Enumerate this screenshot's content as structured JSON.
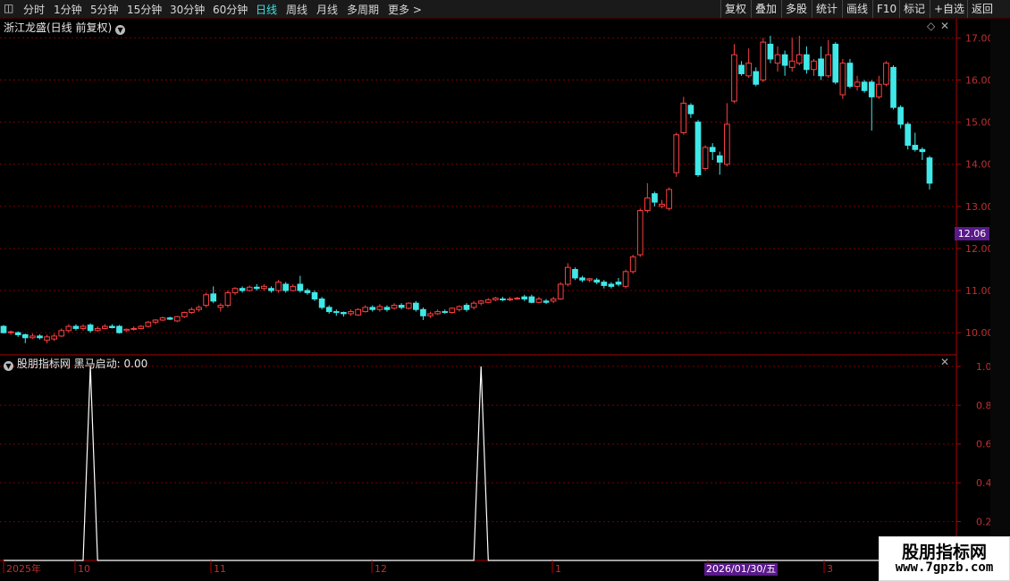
{
  "toolbar": {
    "periods": [
      "分时",
      "1分钟",
      "5分钟",
      "15分钟",
      "30分钟",
      "60分钟",
      "日线",
      "周线",
      "月线",
      "多周期",
      "更多 >"
    ],
    "active_period": "日线",
    "right_buttons": [
      "复权",
      "叠加",
      "多股",
      "统计",
      "画线",
      "F10",
      "标记",
      "+自选",
      "返回"
    ]
  },
  "main_header": {
    "title": "浙江龙盛(日线 前复权)"
  },
  "sub_header": {
    "title": "股朋指标网 黑马启动: 0.00"
  },
  "price_axis": {
    "ticks": [
      "17.00",
      "16.00",
      "15.00",
      "14.00",
      "13.00",
      "12.00",
      "11.00",
      "10.00"
    ],
    "current": "12.06"
  },
  "indicator_axis": {
    "ticks": [
      "1.00",
      "0.80",
      "0.60",
      "0.40",
      "0.20"
    ]
  },
  "time_axis": {
    "labels": [
      "2025年",
      "10",
      "11",
      "12",
      "1",
      "2",
      "3"
    ],
    "cursor_date": "2026/01/30/五"
  },
  "watermark": {
    "title": "股朋指标网",
    "url": "www.7gpzb.com"
  },
  "colors": {
    "up": "#ff4040",
    "down": "#40e8e8",
    "indicator": "#ffffff",
    "grid": "#7a0000",
    "axis": "#b00000",
    "label": "#c03030"
  },
  "chart_data": [
    {
      "type": "candlestick",
      "title": "浙江龙盛(日线 前复权)",
      "ylim": [
        9.6,
        17.2
      ],
      "candles": [
        [
          10.15,
          10.0,
          10.18,
          9.98
        ],
        [
          10.0,
          10.02,
          10.05,
          9.95
        ],
        [
          10.0,
          9.95,
          10.03,
          9.9
        ],
        [
          9.95,
          9.88,
          9.98,
          9.75
        ],
        [
          9.88,
          9.92,
          9.98,
          9.85
        ],
        [
          9.92,
          9.88,
          9.96,
          9.84
        ],
        [
          9.82,
          9.9,
          9.95,
          9.75
        ],
        [
          9.85,
          9.92,
          9.98,
          9.8
        ],
        [
          9.92,
          10.05,
          10.1,
          9.9
        ],
        [
          10.05,
          10.15,
          10.2,
          10.0
        ],
        [
          10.15,
          10.1,
          10.2,
          10.05
        ],
        [
          10.1,
          10.15,
          10.2,
          10.05
        ],
        [
          10.18,
          10.05,
          10.22,
          10.0
        ],
        [
          10.05,
          10.1,
          10.15,
          10.02
        ],
        [
          10.1,
          10.15,
          10.2,
          10.08
        ],
        [
          10.15,
          10.12,
          10.2,
          10.1
        ],
        [
          10.15,
          10.0,
          10.18,
          9.98
        ],
        [
          10.05,
          10.08,
          10.1,
          10.02
        ],
        [
          10.08,
          10.1,
          10.15,
          10.05
        ],
        [
          10.1,
          10.15,
          10.18,
          10.08
        ],
        [
          10.15,
          10.25,
          10.28,
          10.12
        ],
        [
          10.25,
          10.3,
          10.32,
          10.2
        ],
        [
          10.3,
          10.35,
          10.38,
          10.28
        ],
        [
          10.35,
          10.32,
          10.38,
          10.3
        ],
        [
          10.28,
          10.38,
          10.4,
          10.25
        ],
        [
          10.38,
          10.48,
          10.5,
          10.35
        ],
        [
          10.48,
          10.55,
          10.6,
          10.45
        ],
        [
          10.55,
          10.6,
          10.65,
          10.5
        ],
        [
          10.65,
          10.9,
          10.95,
          10.6
        ],
        [
          10.92,
          10.75,
          11.1,
          10.7
        ],
        [
          10.6,
          10.65,
          10.7,
          10.5
        ],
        [
          10.65,
          10.95,
          11.0,
          10.6
        ],
        [
          10.95,
          11.05,
          11.08,
          10.9
        ],
        [
          11.05,
          11.0,
          11.1,
          10.95
        ],
        [
          11.0,
          11.08,
          11.12,
          10.98
        ],
        [
          11.08,
          11.05,
          11.15,
          11.0
        ],
        [
          11.05,
          11.1,
          11.15,
          11.0
        ],
        [
          11.05,
          11.0,
          11.1,
          10.95
        ],
        [
          11.0,
          11.2,
          11.25,
          10.95
        ],
        [
          11.15,
          11.0,
          11.2,
          10.95
        ],
        [
          11.0,
          11.1,
          11.15,
          10.98
        ],
        [
          11.15,
          11.0,
          11.35,
          10.95
        ],
        [
          11.0,
          10.95,
          11.05,
          10.9
        ],
        [
          10.95,
          10.8,
          11.0,
          10.75
        ],
        [
          10.8,
          10.6,
          10.85,
          10.55
        ],
        [
          10.6,
          10.5,
          10.65,
          10.45
        ],
        [
          10.5,
          10.48,
          10.55,
          10.4
        ],
        [
          10.48,
          10.45,
          10.5,
          10.38
        ],
        [
          10.45,
          10.5,
          10.55,
          10.4
        ],
        [
          10.42,
          10.55,
          10.58,
          10.4
        ],
        [
          10.5,
          10.6,
          10.65,
          10.48
        ],
        [
          10.6,
          10.55,
          10.65,
          10.5
        ],
        [
          10.55,
          10.62,
          10.68,
          10.5
        ],
        [
          10.6,
          10.55,
          10.65,
          10.5
        ],
        [
          10.58,
          10.65,
          10.7,
          10.55
        ],
        [
          10.65,
          10.6,
          10.7,
          10.55
        ],
        [
          10.58,
          10.7,
          10.72,
          10.55
        ],
        [
          10.7,
          10.55,
          10.75,
          10.5
        ],
        [
          10.55,
          10.4,
          10.6,
          10.3
        ],
        [
          10.4,
          10.45,
          10.5,
          10.35
        ],
        [
          10.45,
          10.5,
          10.55,
          10.42
        ],
        [
          10.5,
          10.48,
          10.55,
          10.45
        ],
        [
          10.48,
          10.58,
          10.6,
          10.45
        ],
        [
          10.55,
          10.62,
          10.65,
          10.5
        ],
        [
          10.65,
          10.55,
          10.7,
          10.5
        ],
        [
          10.6,
          10.7,
          10.75,
          10.55
        ],
        [
          10.7,
          10.75,
          10.78,
          10.65
        ],
        [
          10.72,
          10.78,
          10.82,
          10.7
        ],
        [
          10.78,
          10.82,
          10.85,
          10.75
        ],
        [
          10.8,
          10.78,
          10.85,
          10.75
        ],
        [
          10.78,
          10.8,
          10.85,
          10.75
        ],
        [
          10.8,
          10.82,
          10.85,
          10.78
        ],
        [
          10.85,
          10.8,
          10.9,
          10.75
        ],
        [
          10.85,
          10.72,
          10.9,
          10.7
        ],
        [
          10.72,
          10.8,
          10.85,
          10.7
        ],
        [
          10.75,
          10.72,
          10.8,
          10.68
        ],
        [
          10.75,
          10.8,
          10.85,
          10.7
        ],
        [
          10.8,
          11.15,
          11.2,
          10.78
        ],
        [
          11.15,
          11.55,
          11.65,
          11.1
        ],
        [
          11.5,
          11.3,
          11.55,
          11.25
        ],
        [
          11.3,
          11.25,
          11.35,
          11.2
        ],
        [
          11.25,
          11.28,
          11.3,
          11.2
        ],
        [
          11.25,
          11.2,
          11.3,
          11.15
        ],
        [
          11.2,
          11.12,
          11.25,
          11.05
        ],
        [
          11.15,
          11.1,
          11.2,
          11.05
        ],
        [
          11.2,
          11.15,
          11.3,
          11.1
        ],
        [
          11.1,
          11.45,
          11.5,
          11.05
        ],
        [
          11.45,
          11.8,
          11.85,
          11.4
        ],
        [
          11.85,
          12.9,
          12.95,
          11.8
        ],
        [
          12.9,
          13.2,
          13.55,
          12.85
        ],
        [
          13.3,
          13.1,
          13.35,
          13.0
        ],
        [
          13.0,
          13.05,
          13.15,
          12.95
        ],
        [
          12.95,
          13.4,
          13.45,
          12.9
        ],
        [
          13.8,
          14.7,
          14.75,
          13.7
        ],
        [
          14.75,
          15.45,
          15.6,
          14.7
        ],
        [
          15.4,
          15.2,
          15.45,
          15.1
        ],
        [
          15.0,
          13.75,
          15.05,
          13.7
        ],
        [
          13.9,
          14.4,
          14.45,
          13.85
        ],
        [
          14.4,
          14.3,
          14.5,
          14.1
        ],
        [
          14.2,
          14.05,
          14.3,
          13.75
        ],
        [
          14.0,
          14.95,
          15.45,
          13.95
        ],
        [
          15.5,
          16.6,
          16.85,
          15.45
        ],
        [
          16.35,
          16.15,
          16.45,
          16.1
        ],
        [
          16.1,
          16.4,
          16.75,
          16.05
        ],
        [
          16.2,
          15.9,
          16.3,
          15.85
        ],
        [
          16.0,
          16.9,
          17.0,
          15.95
        ],
        [
          16.85,
          16.5,
          17.05,
          16.4
        ],
        [
          16.4,
          16.6,
          16.8,
          16.2
        ],
        [
          16.6,
          16.35,
          16.7,
          16.1
        ],
        [
          16.3,
          16.45,
          17.0,
          16.2
        ],
        [
          16.4,
          16.6,
          17.05,
          16.35
        ],
        [
          16.6,
          16.25,
          16.8,
          16.15
        ],
        [
          16.25,
          16.45,
          16.5,
          16.1
        ],
        [
          16.5,
          16.1,
          16.8,
          16.0
        ],
        [
          16.1,
          16.6,
          16.95,
          16.05
        ],
        [
          16.85,
          15.95,
          16.9,
          15.9
        ],
        [
          15.65,
          16.4,
          16.5,
          15.55
        ],
        [
          16.4,
          15.85,
          16.5,
          15.8
        ],
        [
          15.85,
          15.95,
          16.1,
          15.75
        ],
        [
          15.95,
          15.75,
          16.0,
          15.7
        ],
        [
          15.95,
          15.6,
          16.0,
          14.8
        ],
        [
          15.6,
          15.9,
          16.1,
          15.55
        ],
        [
          15.9,
          16.4,
          16.45,
          15.85
        ],
        [
          16.3,
          15.35,
          16.35,
          15.3
        ],
        [
          15.35,
          14.95,
          15.4,
          14.85
        ],
        [
          14.95,
          14.45,
          15.0,
          14.35
        ],
        [
          14.45,
          14.35,
          14.75,
          14.3
        ],
        [
          14.35,
          14.3,
          14.4,
          14.1
        ],
        [
          14.15,
          13.55,
          14.2,
          13.4
        ]
      ]
    },
    {
      "type": "line",
      "title": "股朋指标网 黑马启动: 0.00",
      "ylim": [
        0,
        1.05
      ],
      "name": "黑马启动",
      "spikes": [
        12,
        66
      ],
      "values": [
        0,
        0,
        0,
        0,
        0,
        0,
        0,
        0,
        0,
        0,
        0,
        0,
        1,
        0,
        0,
        0,
        0,
        0,
        0,
        0,
        0,
        0,
        0,
        0,
        0,
        0,
        0,
        0,
        0,
        0,
        0,
        0,
        0,
        0,
        0,
        0,
        0,
        0,
        0,
        0,
        0,
        0,
        0,
        0,
        0,
        0,
        0,
        0,
        0,
        0,
        0,
        0,
        0,
        0,
        0,
        0,
        0,
        0,
        0,
        0,
        0,
        0,
        0,
        0,
        0,
        0,
        1,
        0,
        0,
        0,
        0,
        0,
        0,
        0,
        0,
        0,
        0,
        0,
        0,
        0,
        0,
        0,
        0,
        0,
        0,
        0,
        0,
        0,
        0,
        0,
        0,
        0,
        0,
        0,
        0,
        0,
        0,
        0,
        0,
        0,
        0,
        0,
        0,
        0,
        0,
        0,
        0,
        0,
        0,
        0,
        0,
        0,
        0,
        0,
        0,
        0,
        0,
        0,
        0,
        0,
        0,
        0,
        0,
        0,
        0,
        0,
        0,
        0,
        0,
        0,
        0
      ]
    }
  ]
}
